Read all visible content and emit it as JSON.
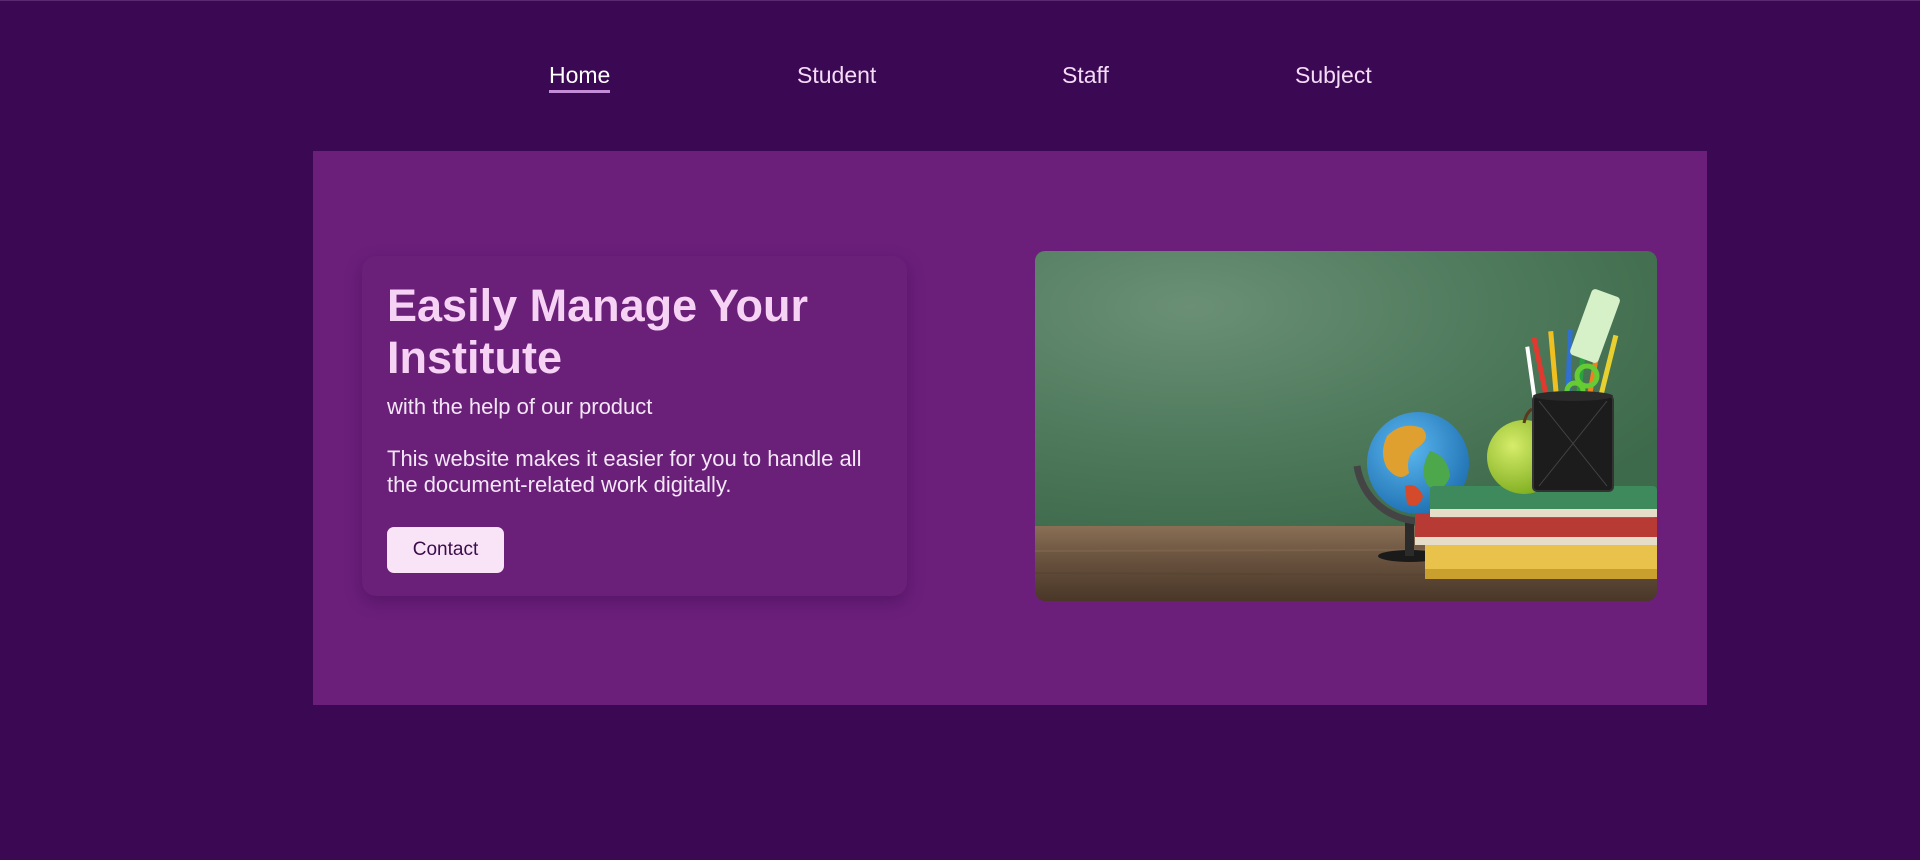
{
  "nav": {
    "items": [
      {
        "label": "Home",
        "active": true
      },
      {
        "label": "Student",
        "active": false
      },
      {
        "label": "Staff",
        "active": false
      },
      {
        "label": "Subject",
        "active": false
      }
    ]
  },
  "hero": {
    "title": "Easily Manage Your Institute",
    "subtitle": "with the help of our product",
    "description": "This website makes it easier for you to handle all the document-related work digitally.",
    "button_label": "Contact"
  },
  "colors": {
    "page_background": "#3b0953",
    "hero_background": "#6b1f7b",
    "title_color": "#f6d3f4",
    "button_background": "#f9e3f7",
    "nav_active_underline": "#c48bd6"
  }
}
